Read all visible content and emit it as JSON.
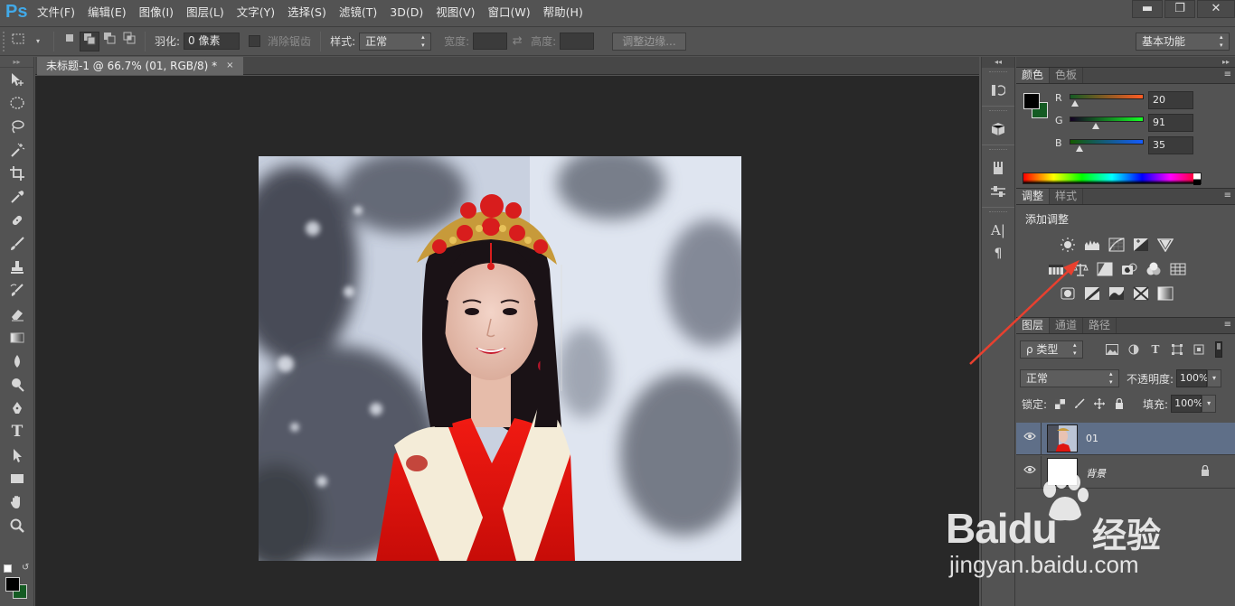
{
  "app": {
    "logo": "Ps",
    "menu": [
      "文件(F)",
      "编辑(E)",
      "图像(I)",
      "图层(L)",
      "文字(Y)",
      "选择(S)",
      "滤镜(T)",
      "3D(D)",
      "视图(V)",
      "窗口(W)",
      "帮助(H)"
    ],
    "window_controls": {
      "minimize": "▬",
      "restore": "❐",
      "close": "✕"
    }
  },
  "options_bar": {
    "feather_label": "羽化:",
    "feather_value": "0 像素",
    "antialias_label": "消除锯齿",
    "style_label": "样式:",
    "style_value": "正常",
    "width_label": "宽度:",
    "height_label": "高度:",
    "refine_edge_button": "调整边缘...",
    "workspace_value": "基本功能"
  },
  "document": {
    "tab_title": "未标题-1 @ 66.7% (01, RGB/8) *",
    "tab_close": "×"
  },
  "color_panel": {
    "tabs": [
      "颜色",
      "色板"
    ],
    "fg_color": "#000000",
    "bg_color": "#145b23",
    "channels": [
      {
        "label": "R",
        "value": "20",
        "fraction": 0.078
      },
      {
        "label": "G",
        "value": "91",
        "fraction": 0.357
      },
      {
        "label": "B",
        "value": "35",
        "fraction": 0.137
      }
    ]
  },
  "adjustments_panel": {
    "tabs": [
      "调整",
      "样式"
    ],
    "title": "添加调整"
  },
  "layers_panel": {
    "tabs": [
      "图层",
      "通道",
      "路径"
    ],
    "filter_kind": "ρ 类型",
    "blend_mode": "正常",
    "opacity_label": "不透明度:",
    "opacity_value": "100%",
    "lock_label": "锁定:",
    "fill_label": "填充:",
    "fill_value": "100%",
    "layers": [
      {
        "name": "01",
        "selected": true,
        "locked": false
      },
      {
        "name": "背景",
        "selected": false,
        "locked": true
      }
    ]
  },
  "watermark": {
    "brand": "Baidu",
    "cn": "经验",
    "url": "jingyan.baidu.com"
  },
  "accent_colors": {
    "selection": "#5f6f88",
    "arrow": "#e8402f",
    "ps_blue": "#41a9e8"
  }
}
